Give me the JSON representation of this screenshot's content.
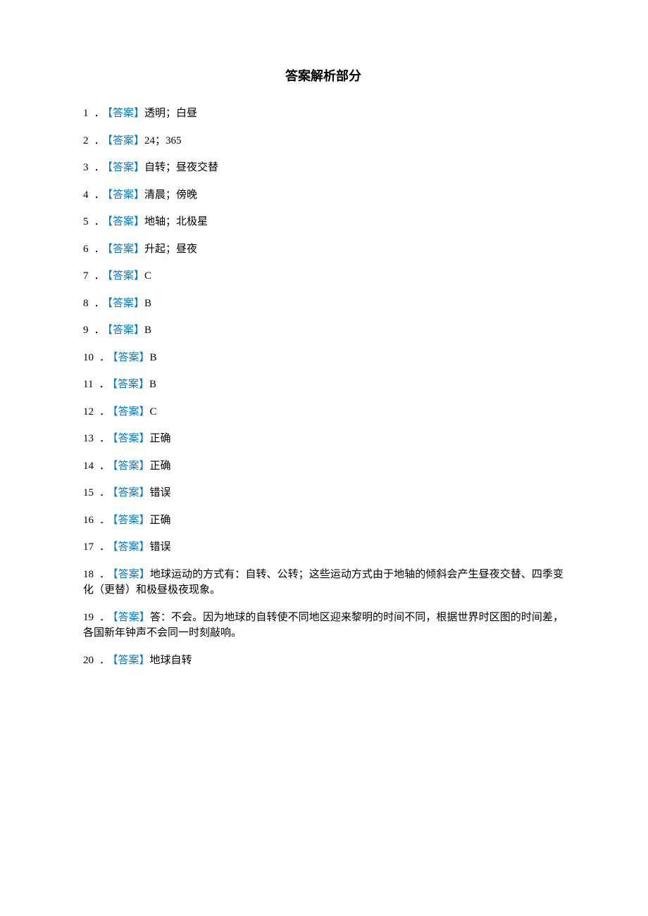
{
  "title": "答案解析部分",
  "tag": "【答案】",
  "dot": "．",
  "items": [
    {
      "num": "1",
      "text": "透明；白昼"
    },
    {
      "num": "2",
      "text": "24；365"
    },
    {
      "num": "3",
      "text": "自转；昼夜交替"
    },
    {
      "num": "4",
      "text": "清晨；傍晚"
    },
    {
      "num": "5",
      "text": "地轴；北极星"
    },
    {
      "num": "6",
      "text": "升起；昼夜"
    },
    {
      "num": "7",
      "text": "C"
    },
    {
      "num": "8",
      "text": "B"
    },
    {
      "num": "9",
      "text": "B"
    },
    {
      "num": "10",
      "text": "B"
    },
    {
      "num": "11",
      "text": "B"
    },
    {
      "num": "12",
      "text": "C"
    },
    {
      "num": "13",
      "text": "正确"
    },
    {
      "num": "14",
      "text": "正确"
    },
    {
      "num": "15",
      "text": "错误"
    },
    {
      "num": "16",
      "text": "正确"
    },
    {
      "num": "17",
      "text": "错误"
    },
    {
      "num": "18",
      "text": "地球运动的方式有：自转、公转；这些运动方式由于地轴的倾斜会产生昼夜交替、四季变化（更替）和极昼极夜现象。"
    },
    {
      "num": "19",
      "text": "答：不会。因为地球的自转使不同地区迎来黎明的时间不同，根据世界时区图的时间差，各国新年钟声不会同一时刻敲响。"
    },
    {
      "num": "20",
      "text": "地球自转"
    }
  ]
}
